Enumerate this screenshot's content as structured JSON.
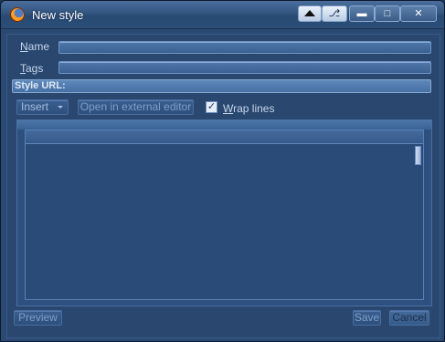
{
  "window": {
    "title": "New style",
    "icon": "firefox-icon",
    "controls": {
      "up": "triangle-up-icon",
      "pin": "pin-icon",
      "minimize": "minimize-icon",
      "maximize": "maximize-icon",
      "close": "close-icon"
    }
  },
  "form": {
    "name_label_key": "N",
    "name_label_rest": "ame",
    "name_value": "",
    "tags_label_key": "T",
    "tags_label_rest": "ags",
    "tags_value": "",
    "url_label": "Style URL:"
  },
  "toolbar": {
    "insert_label": "Insert",
    "external_editor_label": "Open in external editor",
    "wrap_key": "W",
    "wrap_rest": "rap lines",
    "wrap_checked": true
  },
  "footer": {
    "preview_label": "Preview",
    "save_label": "Save",
    "cancel_label": "Cancel"
  },
  "colors": {
    "background": "#29476f",
    "titlebar": "#32557f",
    "field": "#4f77a8",
    "disabled_text": "#7e9ec8"
  }
}
